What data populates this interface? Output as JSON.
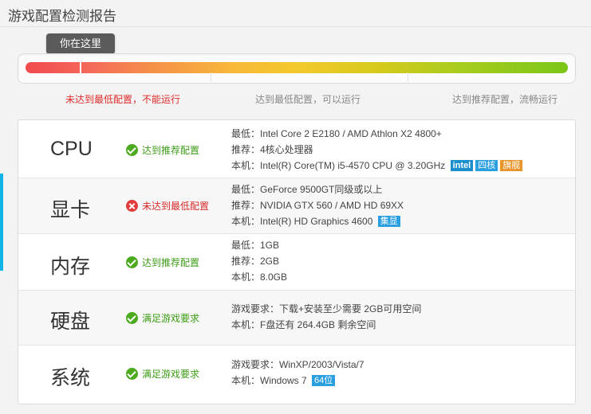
{
  "header": {
    "title": "游戏配置检测报告"
  },
  "progress": {
    "you_are_here": "你在这里",
    "position": 0.1,
    "labels": {
      "below_min": "未达到最低配置，不能运行",
      "min": "达到最低配置，可以运行",
      "recommended": "达到推荐配置，流畅运行"
    }
  },
  "colors": {
    "ok": "#4caa1e",
    "bad": "#e13b3b",
    "accent": "#12b4e8"
  },
  "rows": {
    "cpu": {
      "name": "CPU",
      "status": "达到推荐配置",
      "lines": [
        "最低：Intel Core 2 E2180 / AMD Athlon X2 4800+",
        "推荐：4核心处理器",
        "本机：Intel(R) Core(TM) i5-4570 CPU @ 3.20GHz"
      ],
      "badges": [
        "intel",
        "四核",
        "旗舰"
      ]
    },
    "gpu": {
      "name": "显卡",
      "status": "未达到最低配置",
      "lines": [
        "最低：GeForce 9500GT同级或以上",
        "推荐：NVIDIA GTX 560 / AMD HD 69XX",
        "本机：Intel(R) HD Graphics 4600"
      ],
      "badges": [
        "集显"
      ]
    },
    "memory": {
      "name": "内存",
      "status": "达到推荐配置",
      "lines": [
        "最低：1GB",
        "推荐：2GB",
        "本机：8.0GB"
      ]
    },
    "disk": {
      "name": "硬盘",
      "status": "满足游戏要求",
      "lines": [
        "游戏要求：下载+安装至少需要 2GB可用空间",
        "本机：F盘还有 264.4GB 剩余空间"
      ]
    },
    "os": {
      "name": "系统",
      "status": "满足游戏要求",
      "lines": [
        "游戏要求：WinXP/2003/Vista/7",
        "本机：Windows 7"
      ],
      "badges": [
        "64位"
      ]
    }
  }
}
